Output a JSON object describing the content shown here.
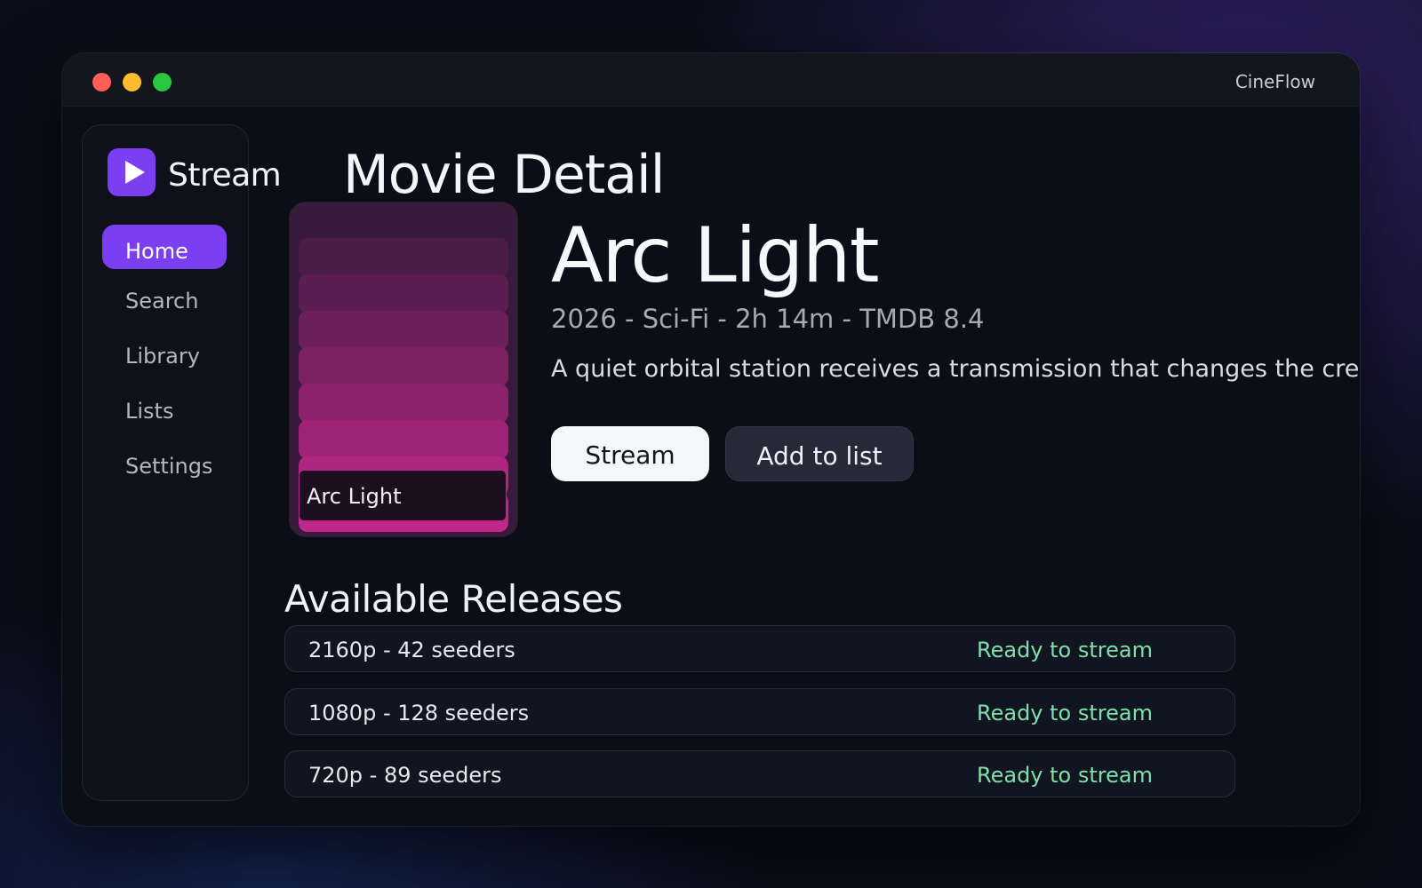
{
  "window": {
    "title": "CineFlow"
  },
  "sidebar": {
    "brand": "Stream",
    "items": [
      {
        "label": "Home",
        "active": true
      },
      {
        "label": "Search",
        "active": false
      },
      {
        "label": "Library",
        "active": false
      },
      {
        "label": "Lists",
        "active": false
      },
      {
        "label": "Settings",
        "active": false
      }
    ]
  },
  "page": {
    "title": "Movie Detail"
  },
  "movie": {
    "poster_title": "Arc Light",
    "title": "Arc Light",
    "meta": "2026 - Sci-Fi - 2h 14m - TMDB 8.4",
    "synopsis": "A quiet orbital station receives a transmission that changes the crew's memo",
    "actions": {
      "stream": "Stream",
      "add_to_list": "Add to list"
    }
  },
  "releases": {
    "title": "Available Releases",
    "items": [
      {
        "label": "2160p - 42 seeders",
        "status": "Ready to stream"
      },
      {
        "label": "1080p - 128 seeders",
        "status": "Ready to stream"
      },
      {
        "label": "720p - 89 seeders",
        "status": "Ready to stream"
      }
    ]
  },
  "colors": {
    "accent": "#7b3ff2",
    "status_ready": "#7ee0a8",
    "poster_top": "#3a1a3c",
    "poster_bottom": "#c0278a"
  },
  "icons": {
    "brand_logo": "play-icon"
  }
}
